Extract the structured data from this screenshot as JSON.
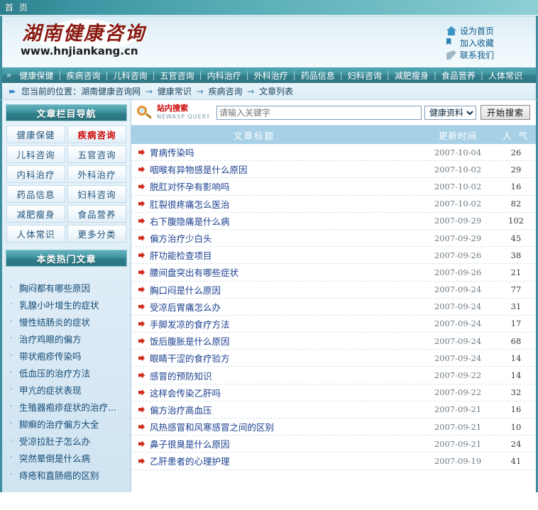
{
  "topbar": {
    "tab_label": "首 页"
  },
  "banner": {
    "logo_cn": "湖南健康咨询",
    "logo_url": "www.hnjiankang.cn",
    "links": [
      {
        "icon": "home-icon",
        "label": "设为首页"
      },
      {
        "icon": "favorite-icon",
        "label": "加入收藏"
      },
      {
        "icon": "mail-icon",
        "label": "联系我们"
      }
    ]
  },
  "nav": {
    "arrows": "»",
    "items": [
      "健康保健",
      "疾病咨询",
      "儿科咨询",
      "五官咨询",
      "内科治疗",
      "外科治疗",
      "药品信息",
      "妇科咨询",
      "减肥瘦身",
      "食品营养",
      "人体常识"
    ]
  },
  "breadcrumb": {
    "arrows": "▸▸",
    "prefix": "您当前的位置：",
    "items": [
      "湖南健康咨询网",
      "健康常识",
      "疾病咨询",
      "文章列表"
    ],
    "separator": "→"
  },
  "sidebar": {
    "nav_panel_title": "文章栏目导航",
    "categories": [
      {
        "label": "健康保健",
        "active": false
      },
      {
        "label": "疾病咨询",
        "active": true
      },
      {
        "label": "儿科咨询",
        "active": false
      },
      {
        "label": "五官咨询",
        "active": false
      },
      {
        "label": "内科治疗",
        "active": false
      },
      {
        "label": "外科治疗",
        "active": false
      },
      {
        "label": "药品信息",
        "active": false
      },
      {
        "label": "妇科咨询",
        "active": false
      },
      {
        "label": "减肥瘦身",
        "active": false
      },
      {
        "label": "食品营养",
        "active": false
      },
      {
        "label": "人体常识",
        "active": false
      },
      {
        "label": "更多分类",
        "active": false
      }
    ],
    "hot_panel_title": "本类热门文章",
    "hot_articles": [
      "胸闷都有哪些原因",
      "乳腺小叶增生的症状",
      "慢性结肠炎的症状",
      "治疗鸡眼的偏方",
      "带状疱疹传染吗",
      "低血压的治疗方法",
      "甲亢的症状表现",
      "生殖器疱疹症状的治疗...",
      "脚癣的治疗偏方大全",
      "受凉拉肚子怎么办",
      "突然晕倒是什么病",
      "痔疮和直肠癌的区别"
    ]
  },
  "search": {
    "caption_cn": "站内搜索",
    "caption_en": "NEWASP QUERY",
    "placeholder": "请输入关键字",
    "value": "",
    "selected_option": "健康资料",
    "options": [
      "健康资料"
    ],
    "button_label": "开始搜索"
  },
  "article_list": {
    "columns": {
      "title": "文章标题",
      "date": "更新时间",
      "hits": "人 气"
    },
    "rows": [
      {
        "title": "胃病传染吗",
        "date": "2007-10-04",
        "hits": "26"
      },
      {
        "title": "咽喉有异物感是什么原因",
        "date": "2007-10-02",
        "hits": "29"
      },
      {
        "title": "脱肛对怀孕有影响吗",
        "date": "2007-10-02",
        "hits": "16"
      },
      {
        "title": "肛裂很疼痛怎么医治",
        "date": "2007-10-02",
        "hits": "82"
      },
      {
        "title": "右下腹隐痛是什么病",
        "date": "2007-09-29",
        "hits": "102"
      },
      {
        "title": "偏方治疗少白头",
        "date": "2007-09-29",
        "hits": "45"
      },
      {
        "title": "肝功能检查项目",
        "date": "2007-09-26",
        "hits": "38"
      },
      {
        "title": "腰间盘突出有哪些症状",
        "date": "2007-09-26",
        "hits": "21"
      },
      {
        "title": "胸口闷是什么原因",
        "date": "2007-09-24",
        "hits": "77"
      },
      {
        "title": "受凉后胃痛怎么办",
        "date": "2007-09-24",
        "hits": "31"
      },
      {
        "title": "手脚发凉的食疗方法",
        "date": "2007-09-24",
        "hits": "17"
      },
      {
        "title": "饭后腹胀是什么原因",
        "date": "2007-09-24",
        "hits": "68"
      },
      {
        "title": "眼睛干涩的食疗验方",
        "date": "2007-09-24",
        "hits": "14"
      },
      {
        "title": "感冒的预防知识",
        "date": "2007-09-22",
        "hits": "14"
      },
      {
        "title": "这样会传染乙肝吗",
        "date": "2007-09-22",
        "hits": "32"
      },
      {
        "title": "偏方治疗高血压",
        "date": "2007-09-21",
        "hits": "16"
      },
      {
        "title": "风热感冒和风寒感冒之间的区别",
        "date": "2007-09-21",
        "hits": "10"
      },
      {
        "title": "鼻子很臭是什么原因",
        "date": "2007-09-21",
        "hits": "24"
      },
      {
        "title": "乙肝患者的心理护理",
        "date": "2007-09-19",
        "hits": "41"
      }
    ]
  },
  "colors": {
    "header_teal": "#3d8f9d",
    "nav_teal": "#3f929f",
    "accent_red": "#cc0000",
    "link_blue": "#1a3f8f",
    "list_head_blue": "#a7d0e6"
  }
}
